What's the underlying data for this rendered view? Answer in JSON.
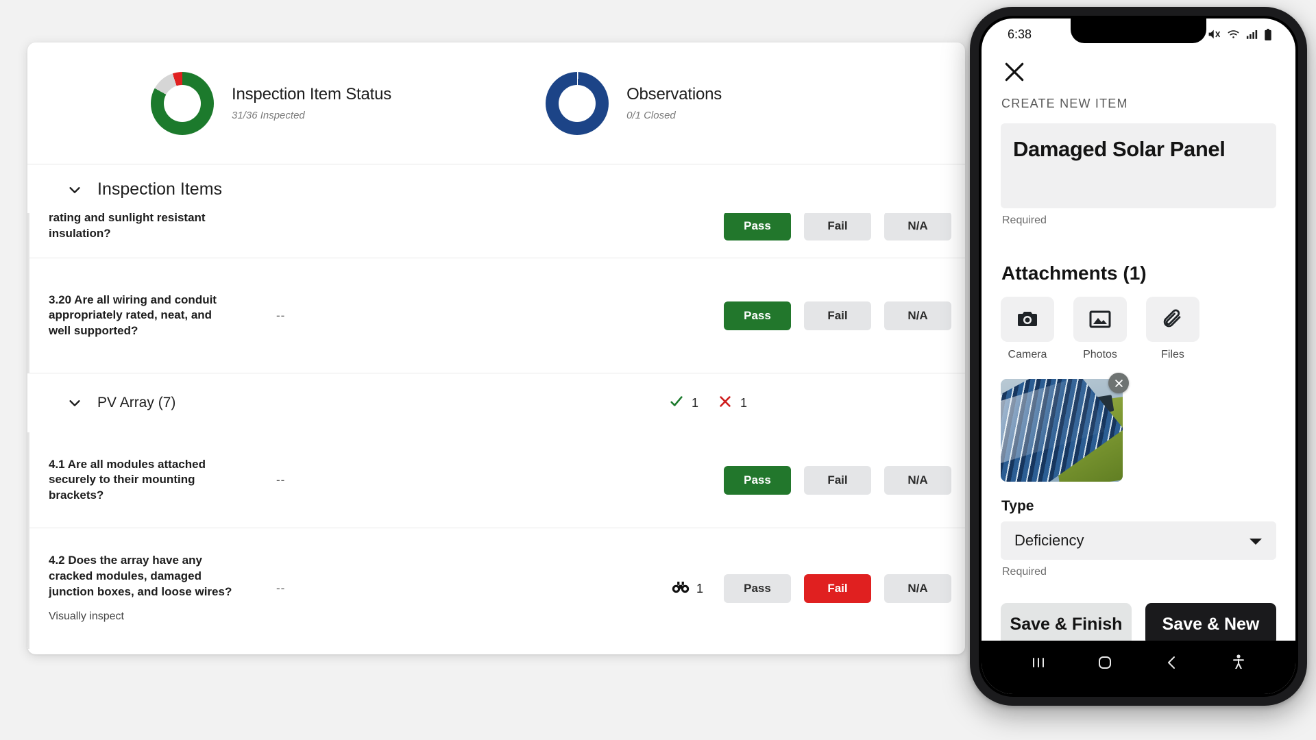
{
  "summary": {
    "cards": [
      {
        "title": "Inspection Item Status",
        "subtitle": "31/36 Inspected",
        "donut": {
          "green_pct": 83,
          "gray_pct": 12,
          "red_pct": 5
        }
      },
      {
        "title": "Observations",
        "subtitle": "0/1 Closed",
        "donut": {
          "blue_pct": 100
        }
      }
    ]
  },
  "inspection": {
    "header": "Inspection Items",
    "chevron_icon": "chevron-down-icon",
    "rows": [
      {
        "question": "rating and sunlight resistant insulation?",
        "note": "",
        "value": "",
        "observations": "",
        "status": "pass",
        "buttons": {
          "pass": "Pass",
          "fail": "Fail",
          "na": "N/A"
        }
      },
      {
        "question": "3.20 Are all wiring and conduit appropriately rated, neat, and well supported?",
        "note": "",
        "value": "--",
        "observations": "",
        "status": "pass",
        "buttons": {
          "pass": "Pass",
          "fail": "Fail",
          "na": "N/A"
        }
      }
    ],
    "group": {
      "title": "PV Array (7)",
      "pass_count": "1",
      "fail_count": "1",
      "check_icon": "check-icon",
      "x_icon": "x-icon"
    },
    "group_rows": [
      {
        "question": "4.1 Are all modules attached securely to their mounting brackets?",
        "note": "",
        "value": "--",
        "observations": "",
        "status": "pass",
        "buttons": {
          "pass": "Pass",
          "fail": "Fail",
          "na": "N/A"
        }
      },
      {
        "question": "4.2 Does the array have any cracked modules, damaged junction boxes, and loose wires?",
        "note": "Visually inspect",
        "value": "--",
        "observations": "1",
        "observations_icon": "binoculars-icon",
        "status": "fail",
        "buttons": {
          "pass": "Pass",
          "fail": "Fail",
          "na": "N/A"
        }
      }
    ]
  },
  "phone": {
    "status_bar": {
      "time": "6:38",
      "icons": [
        "mute-icon",
        "wifi-icon",
        "signal-icon",
        "battery-icon"
      ]
    },
    "close_icon": "close-icon",
    "screen_label": "CREATE NEW ITEM",
    "title_value": "Damaged Solar Panel",
    "title_required": "Required",
    "attachments": {
      "heading": "Attachments (1)",
      "buttons": [
        {
          "label": "Camera",
          "icon": "camera-icon"
        },
        {
          "label": "Photos",
          "icon": "photo-icon"
        },
        {
          "label": "Files",
          "icon": "paperclip-icon"
        }
      ],
      "thumbnail_remove_icon": "close-circle-icon"
    },
    "type": {
      "label": "Type",
      "value": "Deficiency",
      "required": "Required",
      "caret_icon": "caret-down-icon"
    },
    "actions": {
      "save_finish": "Save & Finish",
      "save_new": "Save & New"
    },
    "navbar": {
      "recents_icon": "recents-icon",
      "home_icon": "home-icon",
      "back_icon": "back-icon",
      "accessibility_icon": "accessibility-icon"
    }
  },
  "colors": {
    "pass_green": "#22772c",
    "fail_red": "#e02020",
    "observation_blue": "#1c4487",
    "neutral_button": "#e4e5e7",
    "dark_button": "#1a1a1c"
  }
}
